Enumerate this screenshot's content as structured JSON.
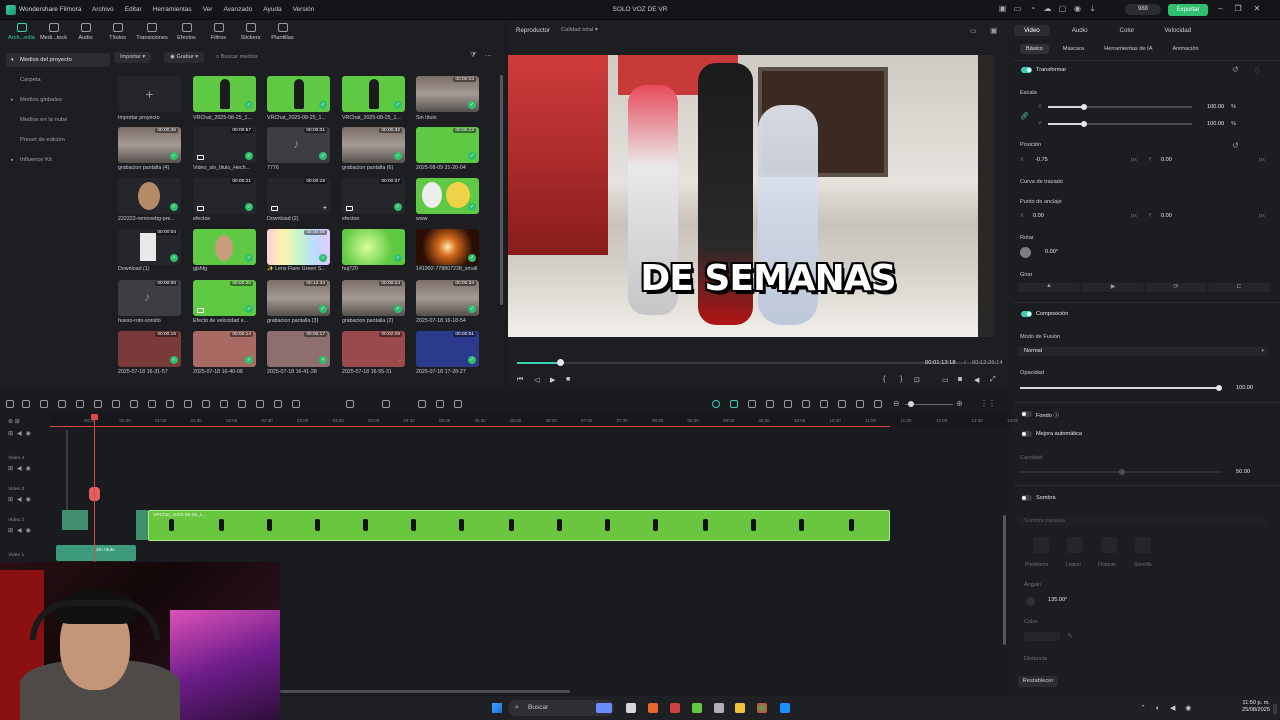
{
  "app": {
    "name": "Wondershare Filmora",
    "project_title": "SOLO VOZ DE VR",
    "credits": "988",
    "export_label": "Exportar"
  },
  "menu": [
    "Archivo",
    "Editar",
    "Herramientas",
    "Ver",
    "Avanzado",
    "Ayuda",
    "Versión"
  ],
  "media_tabs": [
    "Arch...edia",
    "Medi...tock",
    "Audio",
    "Títulos",
    "Transiciones",
    "Efectos",
    "Filtros",
    "Stickers",
    "Plantillas"
  ],
  "sidebar": [
    "Medios del proyecto",
    "Carpeta",
    "Medios globales",
    "Medios en la nube",
    "Preset de edición",
    "Influence Kit"
  ],
  "media_toolbar": {
    "import": "Importar",
    "record": "Grabar",
    "search_placeholder": "Buscar medios"
  },
  "media_items": [
    {
      "label": "Importar proyecto",
      "duration": ""
    },
    {
      "label": "VRChat_2025-08-25_1...",
      "duration": ""
    },
    {
      "label": "VRChat_2025-08-25_1...",
      "duration": ""
    },
    {
      "label": "VRChat_2025-08-25_1...",
      "duration": ""
    },
    {
      "label": "Sin título",
      "duration": "00:00:03"
    },
    {
      "label": "grabacion pantalla (4)",
      "duration": "00:00:36"
    },
    {
      "label": "Video_sin_titulo_Hech...",
      "duration": "00:00:57"
    },
    {
      "label": "7776",
      "duration": "00:00:01"
    },
    {
      "label": "grabacion pantalla (6)",
      "duration": "00:00:32"
    },
    {
      "label": "2025-08-09 21-20-04",
      "duration": "00:00:23"
    },
    {
      "label": "222222-removebg-pre...",
      "duration": ""
    },
    {
      "label": "efectos",
      "duration": "00:00:21"
    },
    {
      "label": "Download (2)",
      "duration": "00:00:19"
    },
    {
      "label": "efectoo",
      "duration": "00:00:27"
    },
    {
      "label": "www",
      "duration": ""
    },
    {
      "label": "Download (1)",
      "duration": "00:00:04"
    },
    {
      "label": "gjshfg",
      "duration": ""
    },
    {
      "label": "✨ Lens Flare Green S...",
      "duration": "00:00:06"
    },
    {
      "label": "huj720",
      "duration": ""
    },
    {
      "label": "141992-778807238_small",
      "duration": ""
    },
    {
      "label": "hueso-roto-sonido",
      "duration": "00:00:00"
    },
    {
      "label": "Efecto de velocidad e...",
      "duration": "00:00:20"
    },
    {
      "label": "grabacion pantalla (3)",
      "duration": "00:12:34"
    },
    {
      "label": "grabacion pantalla (2)",
      "duration": "00:00:24"
    },
    {
      "label": "2025-07-18 16-18-54",
      "duration": "00:00:34"
    },
    {
      "label": "2025-07-18 16-31-57",
      "duration": "00:00:15"
    },
    {
      "label": "2025-07-18 16-40-08",
      "duration": "00:00:14"
    },
    {
      "label": "2025-07-18 16-41-28",
      "duration": "00:00:17"
    },
    {
      "label": "2025-07-18 16-55-31",
      "duration": "00:02:09"
    },
    {
      "label": "2025-07-18 17-28-27",
      "duration": "00:00:51"
    }
  ],
  "player": {
    "label": "Reproductor",
    "quality": "Calidad total",
    "caption": "DE SEMANAS",
    "current_time": "00:01:13:18",
    "separator": "/",
    "total_time": "00:12:26:14",
    "progress_fraction": 0.09
  },
  "props": {
    "tabs": [
      "Video",
      "Audio",
      "Color",
      "Velocidad"
    ],
    "subtabs": [
      "Básico",
      "Máscara",
      "Herramientas de IA",
      "Animación"
    ],
    "transform": "Transformar",
    "scale": "Escala",
    "scale_x": "100.00",
    "scale_y": "100.00",
    "pct": "%",
    "position": "Posición",
    "pos_x": "-0.75",
    "pos_y": "0.00",
    "px": "px",
    "curve": "Curva de trazado",
    "anchor": "Punto de anclaje",
    "anchor_x": "0.00",
    "anchor_y": "0.00",
    "rotate": "Rotar",
    "rotate_val": "0.00°",
    "flip": "Girar",
    "composition": "Composición",
    "blend_mode": "Modo de Fusión",
    "blend_value": "Normal",
    "opacity": "Opacidad",
    "opacity_val": "100.00",
    "background": "Fondo ⓘ",
    "auto_enhance": "Mejora automática",
    "amount": "Cantidad",
    "amount_val": "50.00",
    "shadow": "Sombra",
    "shadow_preset": "Sombra paralela",
    "shadow_opts": [
      "Predeterm.",
      "Lejano",
      "Flotante",
      "Sencilla"
    ],
    "angle": "Ángulo",
    "angle_val": "135.00°",
    "color": "Color",
    "distance": "Distancia",
    "reset": "Restablecer"
  },
  "timeline": {
    "ticks": [
      "00:00",
      "00:30",
      "01:00",
      "01:30",
      "02:00",
      "02:30",
      "03:00",
      "03:30",
      "04:00",
      "04:30",
      "05:00",
      "05:30",
      "06:00",
      "06:30",
      "07:00",
      "07:30",
      "08:00",
      "08:30",
      "09:00",
      "09:30",
      "10:00",
      "10:30",
      "11:00",
      "11:30",
      "12:00",
      "12:30",
      "13:00"
    ],
    "tracks": [
      "Video 4",
      "Video 3",
      "Video 2",
      "Video 1"
    ],
    "clip_green_title": "VRChat_2025-08-25_1...",
    "clip_v1_title": "Sin título"
  },
  "taskbar": {
    "search": "Buscar",
    "time": "11:50 p. m.",
    "date": "25/08/2025"
  }
}
